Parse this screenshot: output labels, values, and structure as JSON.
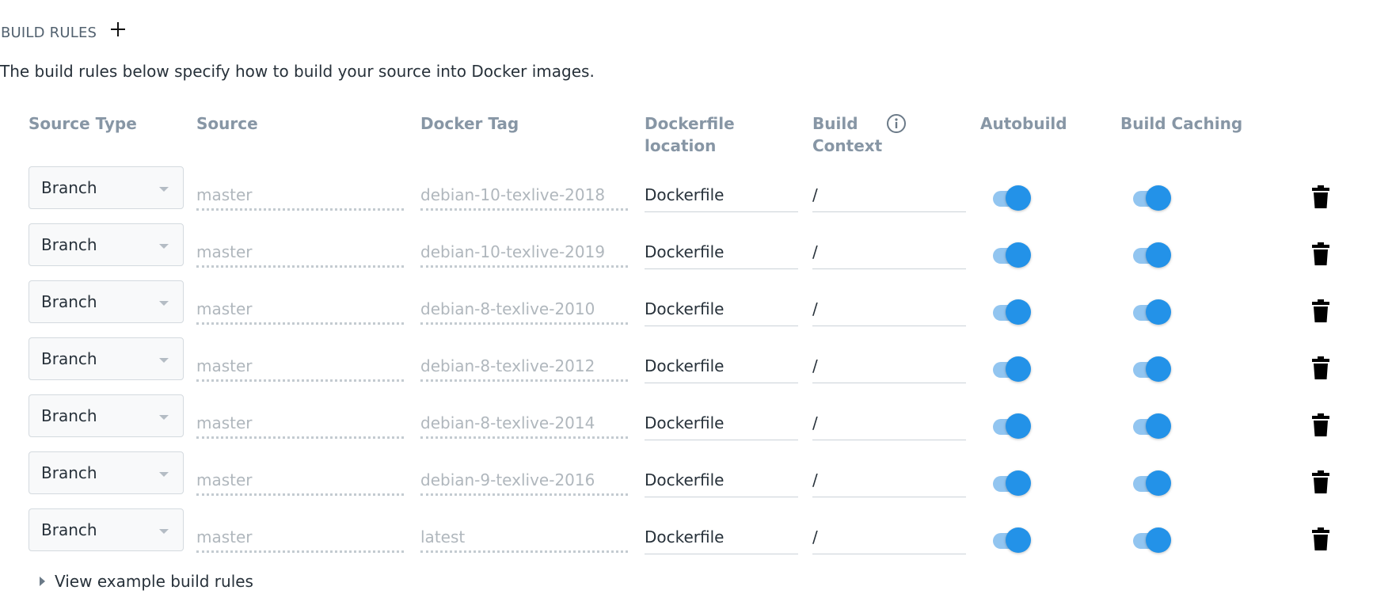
{
  "header": {
    "title": "BUILD RULES",
    "add_icon": "plus-icon"
  },
  "description": "The build rules below specify how to build your source into Docker images.",
  "columns": {
    "source_type": "Source Type",
    "source": "Source",
    "docker_tag": "Docker Tag",
    "dockerfile_location_1": "Dockerfile",
    "dockerfile_location_2": "location",
    "build_context_1": "Build",
    "build_context_2": "Context",
    "build_context_info_icon": "info-icon",
    "autobuild": "Autobuild",
    "build_caching": "Build Caching"
  },
  "rules": [
    {
      "source_type": "Branch",
      "source": "master",
      "docker_tag": "debian-10-texlive-2018",
      "dockerfile": "Dockerfile",
      "context": "/",
      "autobuild": true,
      "caching": true
    },
    {
      "source_type": "Branch",
      "source": "master",
      "docker_tag": "debian-10-texlive-2019",
      "dockerfile": "Dockerfile",
      "context": "/",
      "autobuild": true,
      "caching": true
    },
    {
      "source_type": "Branch",
      "source": "master",
      "docker_tag": "debian-8-texlive-2010",
      "dockerfile": "Dockerfile",
      "context": "/",
      "autobuild": true,
      "caching": true
    },
    {
      "source_type": "Branch",
      "source": "master",
      "docker_tag": "debian-8-texlive-2012",
      "dockerfile": "Dockerfile",
      "context": "/",
      "autobuild": true,
      "caching": true
    },
    {
      "source_type": "Branch",
      "source": "master",
      "docker_tag": "debian-8-texlive-2014",
      "dockerfile": "Dockerfile",
      "context": "/",
      "autobuild": true,
      "caching": true
    },
    {
      "source_type": "Branch",
      "source": "master",
      "docker_tag": "debian-9-texlive-2016",
      "dockerfile": "Dockerfile",
      "context": "/",
      "autobuild": true,
      "caching": true
    },
    {
      "source_type": "Branch",
      "source": "master",
      "docker_tag": "latest",
      "dockerfile": "Dockerfile",
      "context": "/",
      "autobuild": true,
      "caching": true
    }
  ],
  "icons": {
    "select_caret": "chevron-down-icon",
    "delete": "trash-icon",
    "footer_toggle": "caret-right-icon"
  },
  "footer": {
    "label": "View example build rules"
  },
  "colors": {
    "toggle_on": "#2392e8",
    "toggle_track": "#92c5f0",
    "header_muted": "#8796a5"
  }
}
